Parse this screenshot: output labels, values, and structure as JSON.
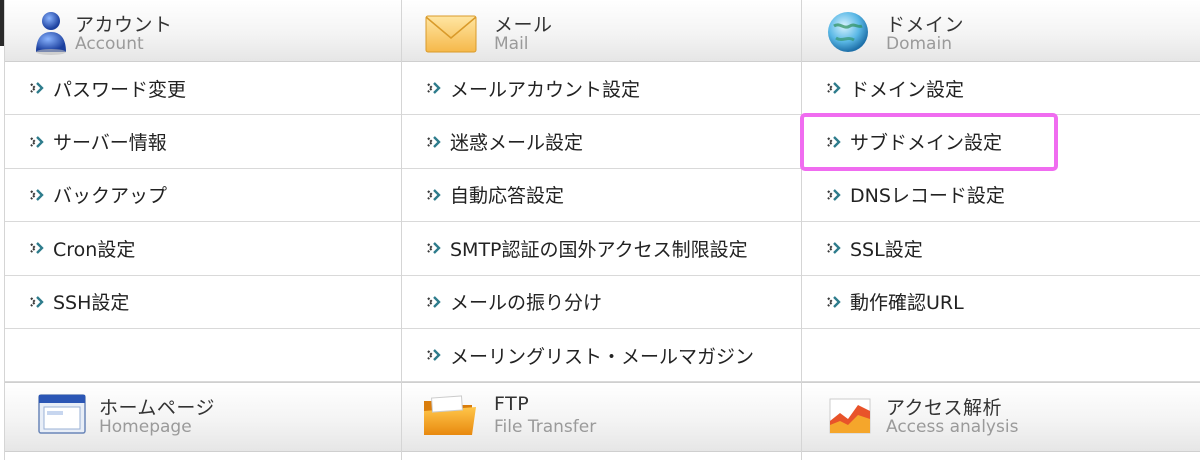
{
  "colors": {
    "highlight": "#f06cf0",
    "arrow_teal": "#2e7c8c",
    "arrow_dark": "#3a3a3a",
    "border": "#d5d5d5"
  },
  "columns": [
    {
      "header": {
        "title": "アカウント",
        "subtitle": "Account",
        "icon": "user-icon"
      },
      "items": [
        {
          "label": "パスワード変更"
        },
        {
          "label": "サーバー情報"
        },
        {
          "label": "バックアップ"
        },
        {
          "label": "Cron設定"
        },
        {
          "label": "SSH設定"
        }
      ],
      "bottom_header": {
        "title": "ホームページ",
        "subtitle": "Homepage",
        "icon": "browser-window-icon"
      }
    },
    {
      "header": {
        "title": "メール",
        "subtitle": "Mail",
        "icon": "envelope-icon"
      },
      "items": [
        {
          "label": "メールアカウント設定"
        },
        {
          "label": "迷惑メール設定"
        },
        {
          "label": "自動応答設定"
        },
        {
          "label": "SMTP認証の国外アクセス制限設定"
        },
        {
          "label": "メールの振り分け"
        },
        {
          "label": "メーリングリスト・メールマガジン"
        }
      ],
      "bottom_header": {
        "title": "FTP",
        "subtitle": "File Transfer",
        "icon": "folder-icon"
      }
    },
    {
      "header": {
        "title": "ドメイン",
        "subtitle": "Domain",
        "icon": "globe-icon"
      },
      "items": [
        {
          "label": "ドメイン設定"
        },
        {
          "label": "サブドメイン設定",
          "highlighted": true
        },
        {
          "label": "DNSレコード設定"
        },
        {
          "label": "SSL設定"
        },
        {
          "label": "動作確認URL"
        }
      ],
      "bottom_header": {
        "title": "アクセス解析",
        "subtitle": "Access analysis",
        "icon": "analytics-chart-icon"
      }
    }
  ]
}
